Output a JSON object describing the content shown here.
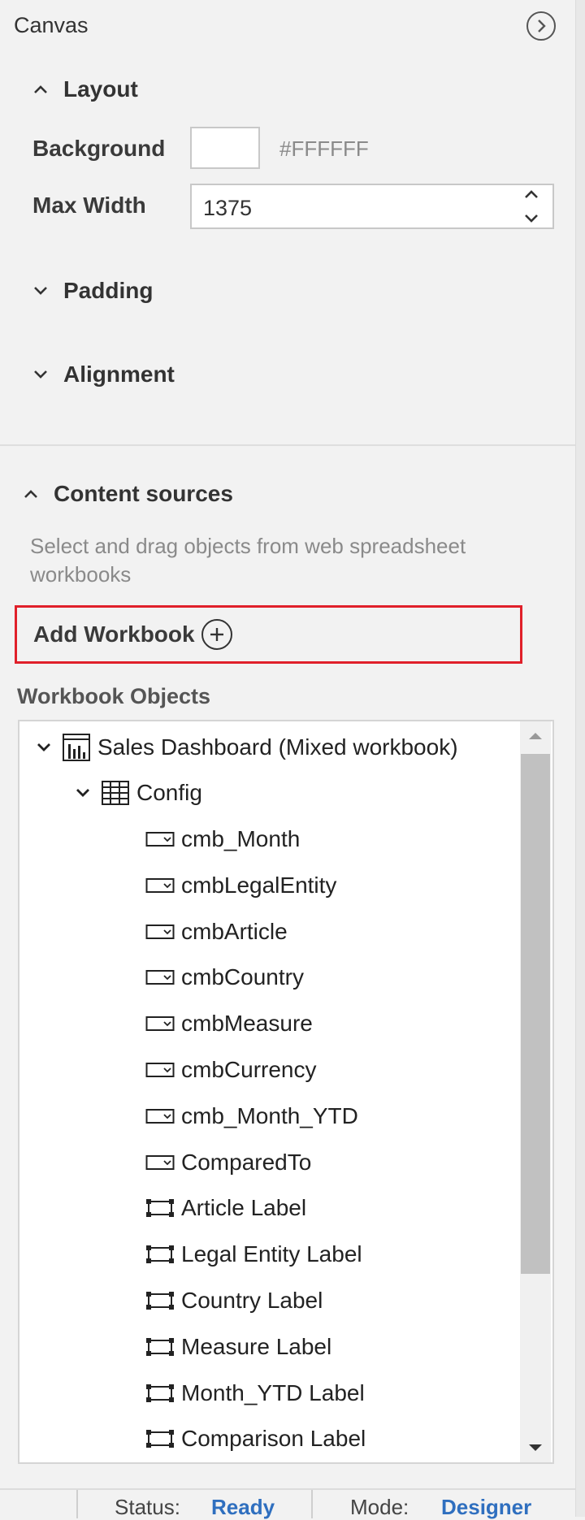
{
  "header": {
    "title": "Canvas"
  },
  "layout": {
    "title": "Layout",
    "background_label": "Background",
    "background_value": "#FFFFFF",
    "background_color": "#ffffff",
    "max_width_label": "Max Width",
    "max_width_value": "1375"
  },
  "padding": {
    "title": "Padding"
  },
  "alignment": {
    "title": "Alignment"
  },
  "content_sources": {
    "title": "Content sources",
    "hint": "Select and drag objects from web spreadsheet workbooks",
    "add_workbook_label": "Add Workbook"
  },
  "workbook_objects": {
    "title": "Workbook Objects",
    "workbook": {
      "label": "Sales Dashboard (Mixed workbook)",
      "icon": "chart-icon"
    },
    "sheet": {
      "label": "Config",
      "icon": "table-icon"
    },
    "items": [
      {
        "label": "cmb_Month",
        "icon": "combobox-icon"
      },
      {
        "label": "cmbLegalEntity",
        "icon": "combobox-icon"
      },
      {
        "label": "cmbArticle",
        "icon": "combobox-icon"
      },
      {
        "label": "cmbCountry",
        "icon": "combobox-icon"
      },
      {
        "label": "cmbMeasure",
        "icon": "combobox-icon"
      },
      {
        "label": "cmbCurrency",
        "icon": "combobox-icon"
      },
      {
        "label": "cmb_Month_YTD",
        "icon": "combobox-icon"
      },
      {
        "label": "ComparedTo",
        "icon": "combobox-icon"
      },
      {
        "label": "Article Label",
        "icon": "label-icon"
      },
      {
        "label": "Legal Entity Label",
        "icon": "label-icon"
      },
      {
        "label": "Country Label",
        "icon": "label-icon"
      },
      {
        "label": "Measure Label",
        "icon": "label-icon"
      },
      {
        "label": "Month_YTD Label",
        "icon": "label-icon"
      },
      {
        "label": "Comparison Label",
        "icon": "label-icon"
      }
    ]
  },
  "status_bar": {
    "status_label": "Status:",
    "status_value": "Ready",
    "mode_label": "Mode:",
    "mode_value": "Designer",
    "accent_color": "#2f6fbf"
  }
}
